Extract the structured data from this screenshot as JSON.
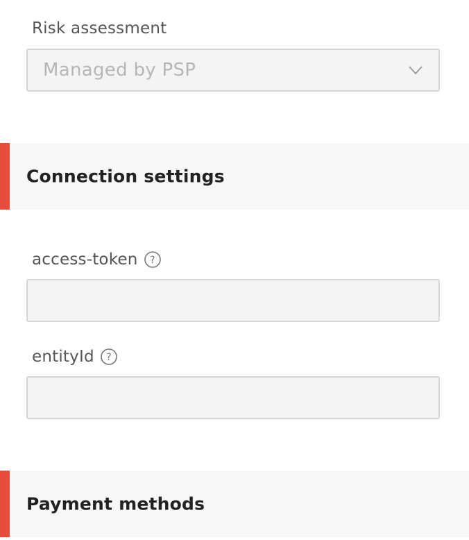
{
  "risk_assessment": {
    "label": "Risk assessment",
    "select_value": "Managed by PSP",
    "icon": "chevron-down-icon"
  },
  "sections": {
    "connection_settings": "Connection settings",
    "payment_methods": "Payment methods"
  },
  "fields": {
    "access_token": {
      "label": "access-token",
      "value": "",
      "icon": "help-icon"
    },
    "entity_id": {
      "label": "entityId",
      "value": "",
      "icon": "help-icon"
    }
  },
  "colors": {
    "accent": "#e74c3c",
    "input_bg": "#f4f4f4",
    "input_border": "#d6d6d6",
    "section_bg": "#f7f7f7"
  }
}
